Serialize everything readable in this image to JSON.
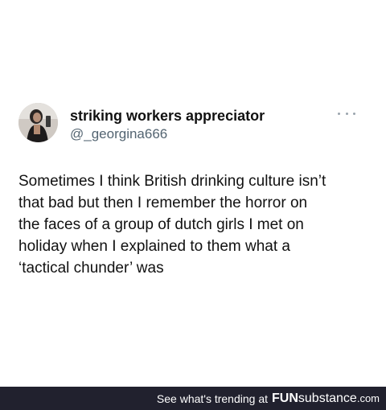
{
  "post": {
    "display_name": "striking workers appreciator",
    "handle": "@_georgina666",
    "body_lines": [
      "Sometimes I think British drinking culture isn’t",
      "that bad but then I remember the horror on",
      "the faces of a group of dutch girls I met on",
      "holiday when I explained to them what a",
      "‘tactical chunder’ was"
    ]
  },
  "footer": {
    "trending_text": "See what's trending at",
    "brand_fun": "FUN",
    "brand_substance": "substance",
    "brand_domain": ".com",
    "background_color": "#21212e"
  },
  "icons": {
    "more": "more-horizontal-icon"
  }
}
